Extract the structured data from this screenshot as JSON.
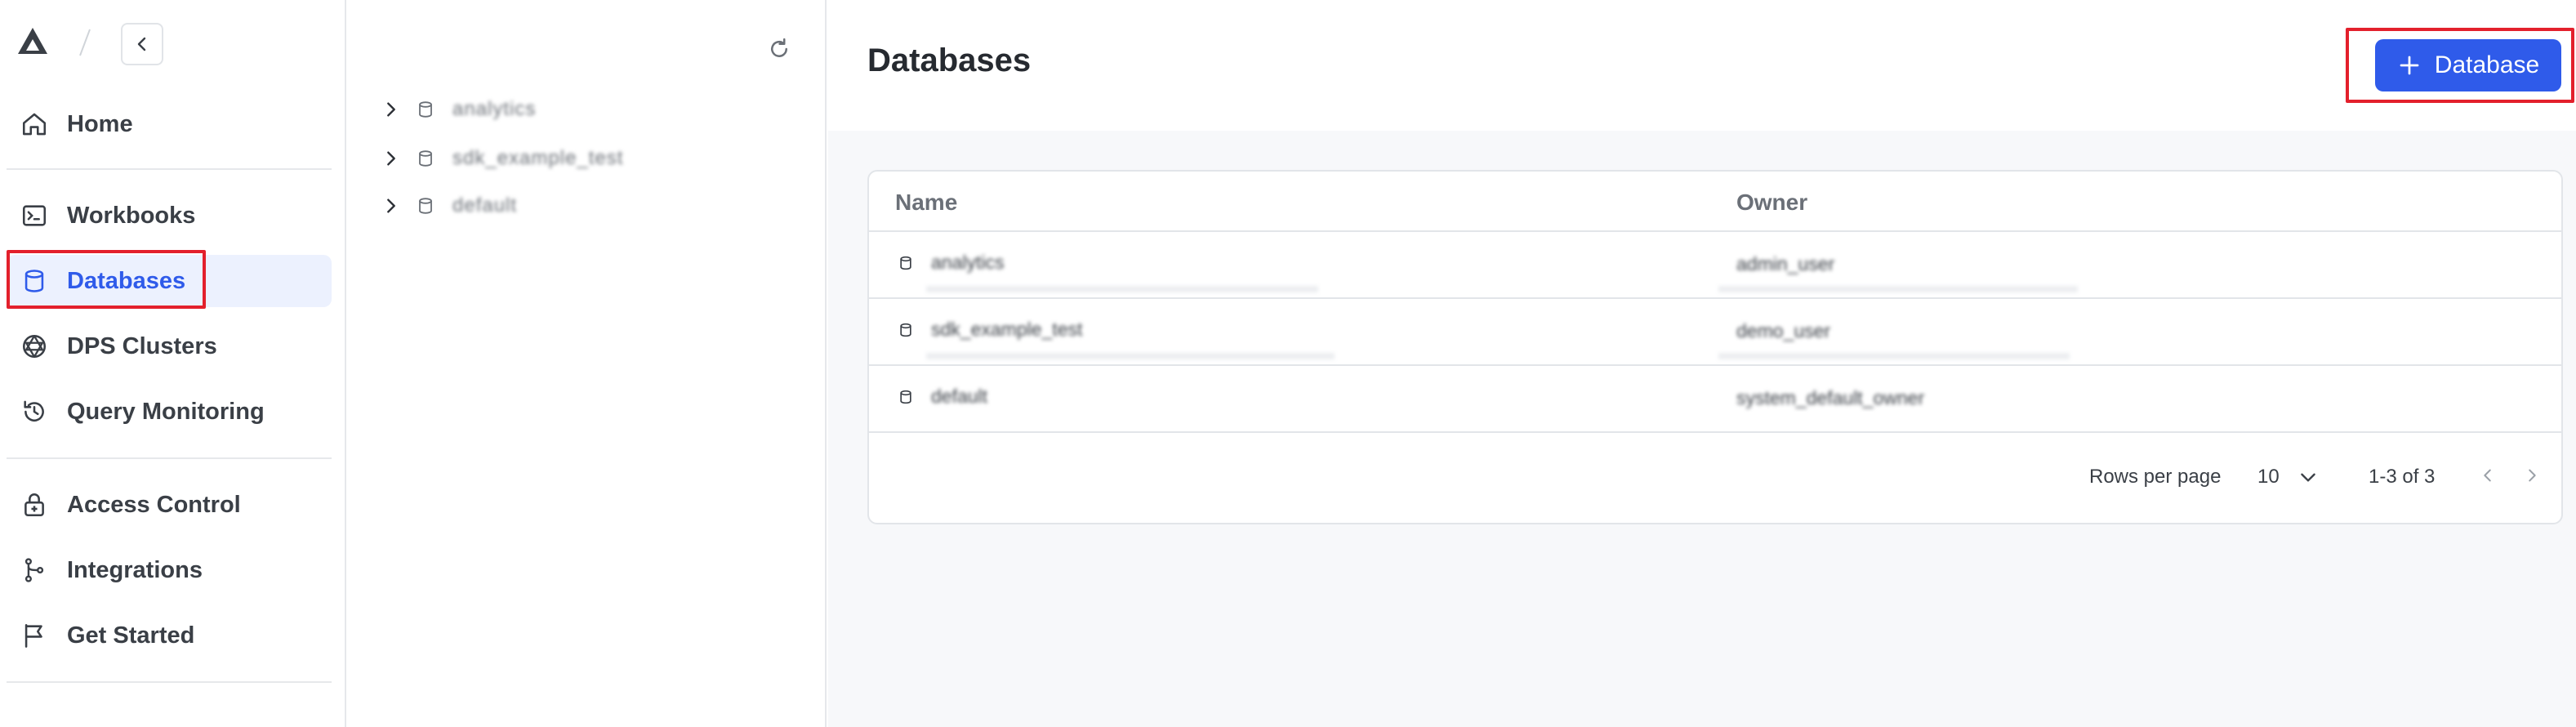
{
  "sidebar": {
    "items": [
      {
        "label": "Home",
        "icon": "home-icon"
      },
      {
        "label": "Workbooks",
        "icon": "terminal-icon"
      },
      {
        "label": "Databases",
        "icon": "database-icon",
        "active": true
      },
      {
        "label": "DPS Clusters",
        "icon": "clusters-icon"
      },
      {
        "label": "Query Monitoring",
        "icon": "history-icon"
      },
      {
        "label": "Access Control",
        "icon": "lock-icon"
      },
      {
        "label": "Integrations",
        "icon": "integrations-icon"
      },
      {
        "label": "Get Started",
        "icon": "flag-icon"
      }
    ]
  },
  "tree": {
    "items": [
      {
        "label": "analytics"
      },
      {
        "label": "sdk_example_test"
      },
      {
        "label": "default"
      }
    ]
  },
  "main": {
    "title": "Databases",
    "add_button_label": "Database",
    "table": {
      "columns": [
        "Name",
        "Owner"
      ],
      "rows": [
        {
          "name": "analytics",
          "owner": "admin_user"
        },
        {
          "name": "sdk_example_test",
          "owner": "demo_user"
        },
        {
          "name": "default",
          "owner": "system_default_owner"
        }
      ]
    },
    "pagination": {
      "rows_per_page_label": "Rows per page",
      "rows_per_page": "10",
      "range": "1-3 of 3"
    }
  },
  "colors": {
    "accent": "#2f5bea",
    "active_bg": "#ecf1fe",
    "highlight": "#e3202c"
  }
}
